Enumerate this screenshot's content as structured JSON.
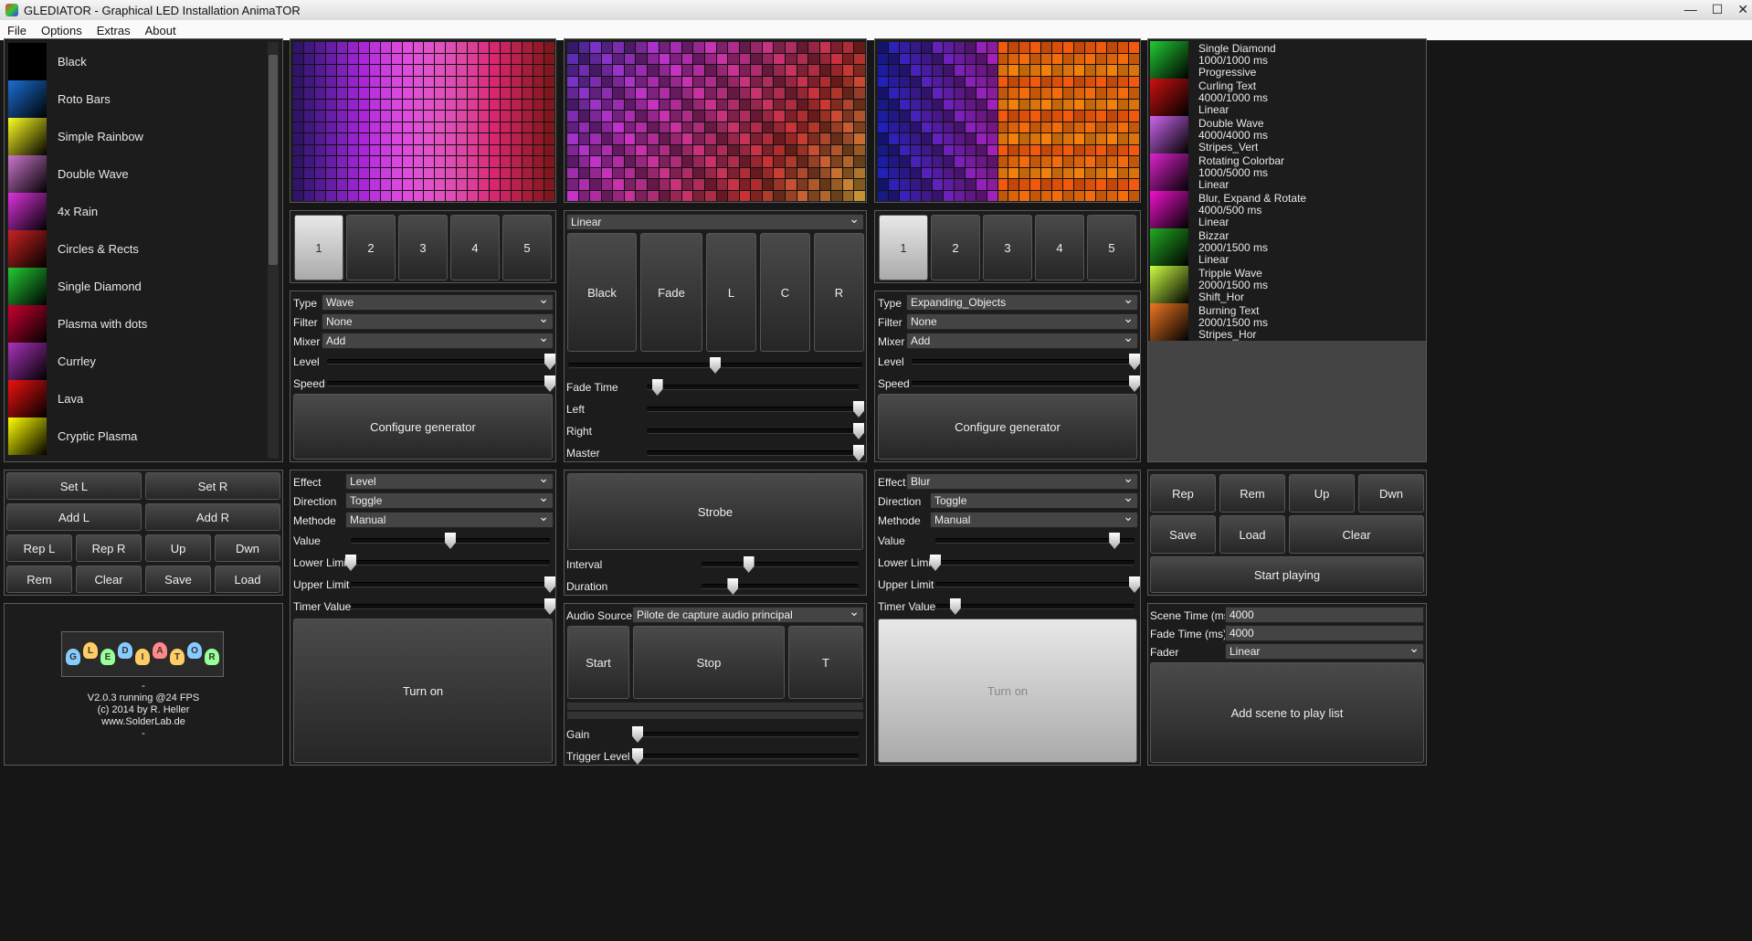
{
  "window": {
    "title": "GLEDIATOR - Graphical LED Installation AnimaTOR",
    "min": "—",
    "max": "☐",
    "close": "✕"
  },
  "menu": [
    "File",
    "Options",
    "Extras",
    "About"
  ],
  "generators": [
    "Black",
    "Roto Bars",
    "Simple Rainbow",
    "Double Wave",
    "4x Rain",
    "Circles & Rects",
    "Single Diamond",
    "Plasma with dots",
    "Currley",
    "Lava",
    "Cryptic Plasma"
  ],
  "generator_thumbs": [
    "#000",
    "#1b6fd6",
    "#ff2",
    "#c7c",
    "#d3d",
    "#c22",
    "#2c3",
    "#c03",
    "#a3b",
    "#e11",
    "#ff0"
  ],
  "left_buttons": {
    "set_l": "Set L",
    "set_r": "Set R",
    "add_l": "Add L",
    "add_r": "Add R",
    "rep_l": "Rep L",
    "rep_r": "Rep R",
    "up": "Up",
    "dwn": "Dwn",
    "rem": "Rem",
    "clear": "Clear",
    "save": "Save",
    "load": "Load"
  },
  "about": {
    "logo": "GLEDIATOR",
    "version": "V2.0.3 running @24 FPS",
    "copyright": "(c) 2014 by R. Heller",
    "url": "www.SolderLab.de",
    "dash1": "-",
    "dash2": "-"
  },
  "slots": [
    "1",
    "2",
    "3",
    "4",
    "5"
  ],
  "deck_l": {
    "type_label": "Type",
    "type": "Wave",
    "filter_label": "Filter",
    "filter": "None",
    "mixer_label": "Mixer",
    "mixer": "Add",
    "level_label": "Level",
    "speed_label": "Speed",
    "configure": "Configure generator",
    "level": 1.0,
    "speed": 1.0
  },
  "deck_r": {
    "type_label": "Type",
    "type": "Expanding_Objects",
    "filter_label": "Filter",
    "filter": "None",
    "mixer_label": "Mixer",
    "mixer": "Add",
    "level_label": "Level",
    "speed_label": "Speed",
    "configure": "Configure generator",
    "level": 1.0,
    "speed": 1.0
  },
  "mixer": {
    "fade_type": "Linear",
    "black": "Black",
    "fade": "Fade",
    "l": "L",
    "c": "C",
    "r": "R",
    "crossfade": 0.5,
    "fade_time_label": "Fade Time",
    "fade_time": 0.05,
    "left_label": "Left",
    "left": 1.0,
    "right_label": "Right",
    "right": 1.0,
    "master_label": "Master",
    "master": 1.0
  },
  "effect_l": {
    "effect_label": "Effect",
    "effect": "Level",
    "direction_label": "Direction",
    "direction": "Toggle",
    "methode_label": "Methode",
    "methode": "Manual",
    "value_label": "Value",
    "value": 0.5,
    "lower_label": "Lower Limit",
    "lower": 0.0,
    "upper_label": "Upper Limit",
    "upper": 1.0,
    "timer_label": "Timer Value",
    "timer": 1.0,
    "turn_on": "Turn on"
  },
  "effect_r": {
    "effect_label": "Effect",
    "effect": "Blur",
    "direction_label": "Direction",
    "direction": "Toggle",
    "methode_label": "Methode",
    "methode": "Manual",
    "value_label": "Value",
    "value": 0.9,
    "lower_label": "Lower Limit",
    "lower": 0.0,
    "upper_label": "Upper Limit",
    "upper": 1.0,
    "timer_label": "Timer Value",
    "timer": 0.1,
    "turn_on": "Turn on"
  },
  "strobe": {
    "label": "Strobe",
    "interval_label": "Interval",
    "interval": 0.3,
    "duration_label": "Duration",
    "duration": 0.2
  },
  "audio": {
    "source_label": "Audio Source",
    "source": "Pilote de capture audio principal",
    "start": "Start",
    "stop": "Stop",
    "t": "T",
    "gain_label": "Gain",
    "gain": 0.0,
    "trigger_label": "Trigger Level",
    "trigger": 0.0
  },
  "playlist": [
    {
      "name": "Single Diamond",
      "time": "1000/1000 ms",
      "mode": "Progressive",
      "color": "#2c3"
    },
    {
      "name": "Curling Text",
      "time": "4000/1000 ms",
      "mode": "Linear",
      "color": "#c11"
    },
    {
      "name": "Double Wave",
      "time": "4000/4000 ms",
      "mode": "Stripes_Vert",
      "color": "#c6e"
    },
    {
      "name": "Rotating Colorbar",
      "time": "1000/5000 ms",
      "mode": "Linear",
      "color": "#d2c"
    },
    {
      "name": "Blur, Expand & Rotate",
      "time": "4000/500 ms",
      "mode": "Linear",
      "color": "#e1c"
    },
    {
      "name": "Bizzar",
      "time": "2000/1500 ms",
      "mode": "Linear",
      "color": "#2a2"
    },
    {
      "name": "Tripple Wave",
      "time": "2000/1500 ms",
      "mode": "Shift_Hor",
      "color": "#cf4"
    },
    {
      "name": "Burning Text",
      "time": "2000/1500 ms",
      "mode": "Stripes_Hor",
      "color": "#e72"
    }
  ],
  "playlist_buttons": {
    "rep": "Rep",
    "rem": "Rem",
    "up": "Up",
    "dwn": "Dwn",
    "save": "Save",
    "load": "Load",
    "clear": "Clear",
    "start": "Start playing"
  },
  "scene": {
    "scene_time_label": "Scene Time (ms)",
    "scene_time": "4000",
    "fade_time_label": "Fade Time (ms)",
    "fade_time": "4000",
    "fader_label": "Fader",
    "fader": "Linear",
    "add": "Add scene to play list"
  }
}
